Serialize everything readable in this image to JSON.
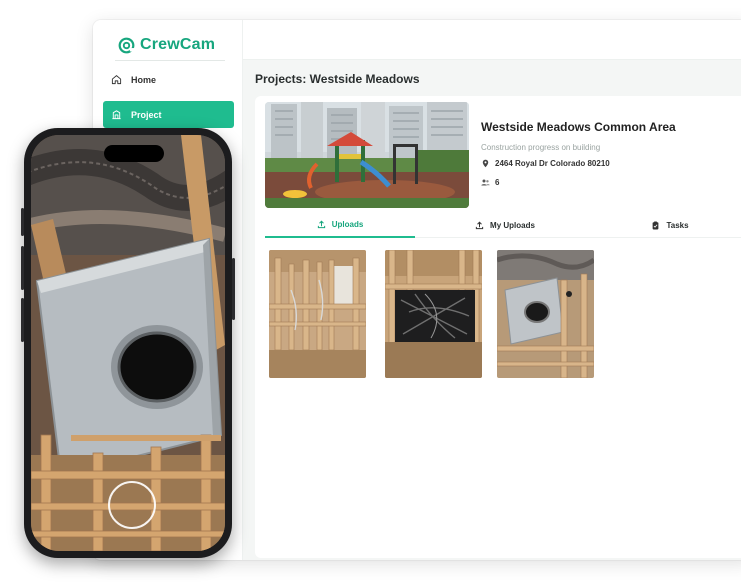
{
  "app": {
    "brand": "CrewCam",
    "accent": "#1fbc8f"
  },
  "sidebar": {
    "items": [
      {
        "label": "Home",
        "icon": "home-icon",
        "active": false
      },
      {
        "label": "Project",
        "icon": "project-icon",
        "active": true
      }
    ]
  },
  "page": {
    "title": "Projects: Westside Meadows"
  },
  "project": {
    "name": "Westside Meadows Common Area",
    "description": "Construction progress on building",
    "address": "2464 Royal  Dr  Colorado 80210",
    "members": "6",
    "hero_image": "playground-photo"
  },
  "tabs": [
    {
      "label": "Uploads",
      "icon": "upload-icon",
      "active": true
    },
    {
      "label": "My Uploads",
      "icon": "upload-icon",
      "active": false
    },
    {
      "label": "Tasks",
      "icon": "clipboard-icon",
      "active": false
    }
  ],
  "uploads": [
    {
      "image": "framing-photo"
    },
    {
      "image": "electrical-box-photo"
    },
    {
      "image": "ductwork-photo"
    }
  ],
  "phone": {
    "view": "camera-viewfinder",
    "subject": "ductwork-photo"
  }
}
